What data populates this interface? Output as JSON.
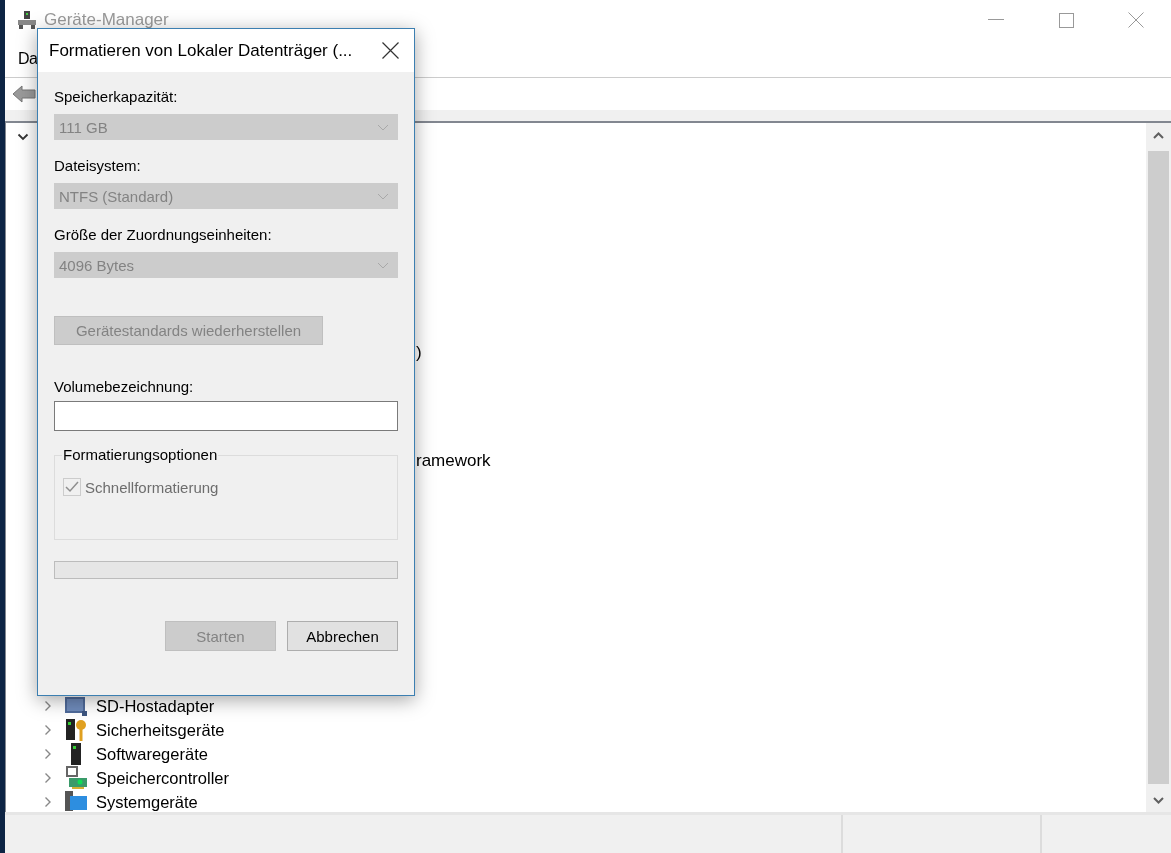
{
  "window": {
    "title": "Geräte-Manager"
  },
  "menu": [
    {
      "label": "Da"
    }
  ],
  "tree": {
    "root": {
      "expanded": true
    },
    "items": [
      {
        "kind": "partial",
        "label": ")"
      },
      {
        "kind": "partial",
        "label": "ramework"
      },
      {
        "kind": "category",
        "label": "SD-Hostadapter",
        "expanded": false
      },
      {
        "kind": "category",
        "label": "Sicherheitsgeräte",
        "expanded": false
      },
      {
        "kind": "category",
        "label": "Softwaregeräte",
        "expanded": false
      },
      {
        "kind": "category",
        "label": "Speichercontroller",
        "expanded": false
      },
      {
        "kind": "category",
        "label": "Systemgeräte",
        "expanded": false
      }
    ]
  },
  "dialog": {
    "title": "Formatieren von Lokaler Datenträger (...",
    "fields": [
      {
        "kind": "combo",
        "label": "Speicherkapazität:",
        "value": "111 GB",
        "disabled": true
      },
      {
        "kind": "combo",
        "label": "Dateisystem:",
        "value": "NTFS (Standard)",
        "disabled": true
      },
      {
        "kind": "combo",
        "label": "Größe der Zuordnungseinheiten:",
        "value": "4096 Bytes",
        "disabled": true
      },
      {
        "kind": "button",
        "label": "Gerätestandards wiederherstellen",
        "disabled": true
      },
      {
        "kind": "text",
        "label": "Volumebezeichnung:",
        "disabled": false
      }
    ],
    "group": {
      "title": "Formatierungsoptionen",
      "options": [
        {
          "label": "Schnellformatierung",
          "checked": true,
          "disabled": true
        }
      ]
    },
    "progress": {
      "level": 0
    },
    "buttons": [
      {
        "label": "Starten",
        "disabled": true
      },
      {
        "label": "Abbrechen",
        "disabled": false
      }
    ]
  }
}
